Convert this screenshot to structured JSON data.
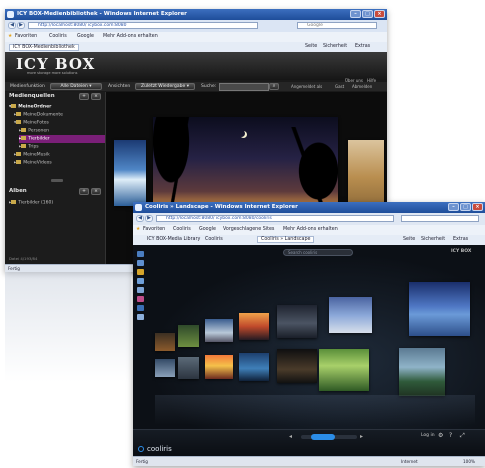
{
  "back_window": {
    "title": "ICY BOX-Medienbibliothek - Windows Internet Explorer",
    "address": "http://localhost:8080/ icybox.com:8080",
    "search_placeholder": "Google",
    "favorites_label": "Favoriten",
    "favorites_items": [
      "Cooliris",
      "Google",
      "Mehr Add-ons erhalten"
    ],
    "tab_label": "ICY BOX-Medienbibliothek",
    "toolbar_right": [
      "Seite",
      "Sicherheit",
      "Extras"
    ],
    "logo_text": "ICY BOX",
    "logo_tagline": "more storage more solutions",
    "header_links": [
      "Über uns",
      "Hilfe"
    ],
    "nav": {
      "media_label": "Medienfunktion",
      "all_files": "Alle Dateien",
      "view_label": "Ansichten",
      "recent": "Zuletzt Wiedergabe",
      "search_label": "Suche:",
      "sort_labels": [
        "Angemeldet als",
        "Gast",
        "Abmelden"
      ]
    },
    "sources_heading": "Medienquellen",
    "tree": [
      {
        "label": "MeineOrdner",
        "level": 0
      },
      {
        "label": "MeineDokumente",
        "level": 1
      },
      {
        "label": "MeineFotos",
        "level": 1
      },
      {
        "label": "Personen",
        "level": 2
      },
      {
        "label": "Tierbilder",
        "level": 2,
        "selected": true
      },
      {
        "label": "Trips",
        "level": 2
      },
      {
        "label": "MeineMusik",
        "level": 1
      },
      {
        "label": "MeineVideos",
        "level": 1
      }
    ],
    "albums_heading": "Alben",
    "album_item": "Tierbilder (160)",
    "status_left": "Fertig",
    "status_mid": "Datei 4/193/84"
  },
  "front_window": {
    "title": "Cooliris » Landscape - Windows Internet Explorer",
    "address": "http://localhost:8080/ icybox.com:8080/cooliris",
    "favorites_label": "Favoriten",
    "favorites_items": [
      "Cooliris",
      "Google",
      "Vorgeschlagene Sites",
      "Mehr Add-ons erhalten"
    ],
    "tabs": [
      "ICY BOX-Media Library",
      "Cooliris",
      "Cooliris » Landscape"
    ],
    "toolbar_right": [
      "Seite",
      "Sicherheit",
      "Extras"
    ],
    "search_placeholder": "Search cooliris",
    "brand_top_right": "ICY BOX",
    "bottom_right": [
      "Log in"
    ],
    "brand_bottom_left": "cooliris",
    "status_left": "Fertig",
    "status_zone": "Internet",
    "zoom": "100%"
  },
  "colors": {
    "ie_title": "#2a5cab",
    "selected_tree": "#7a1f78",
    "dark_bg": "#151515",
    "cooliris_bg": "#0c1016",
    "accent_blue": "#2b8de8"
  }
}
